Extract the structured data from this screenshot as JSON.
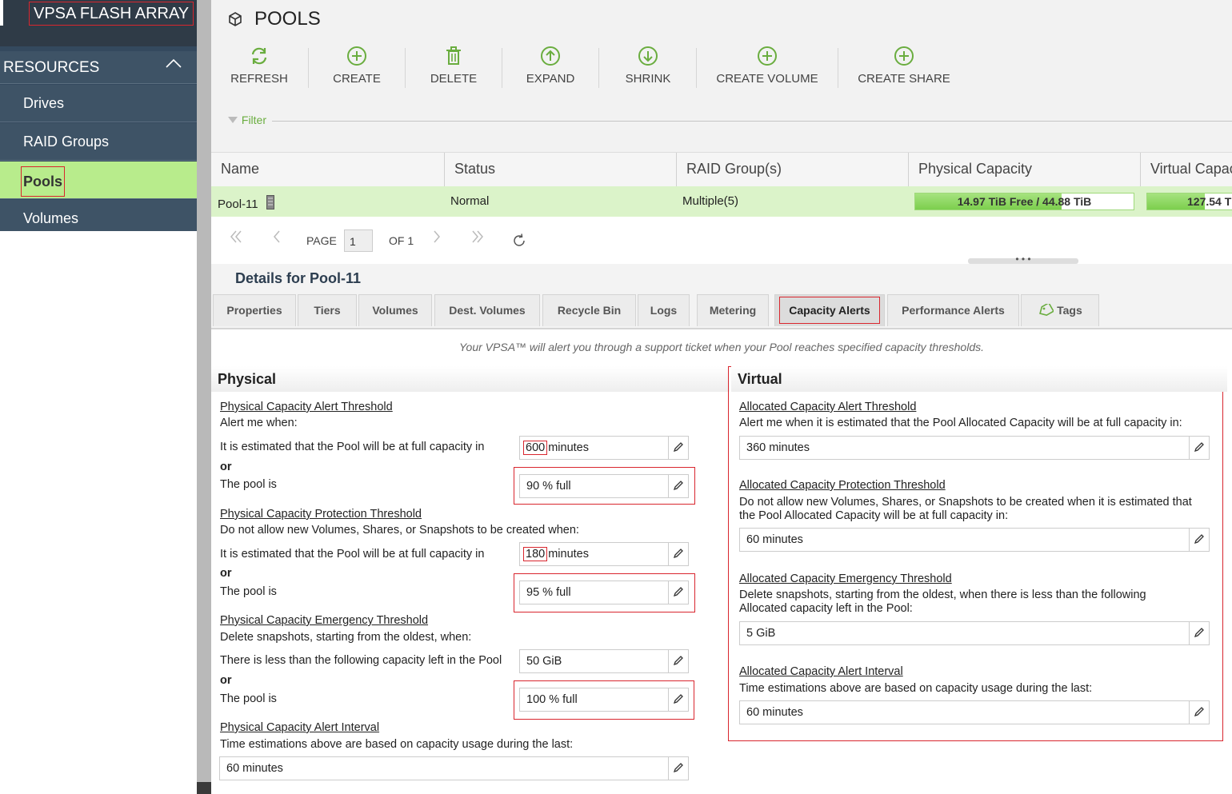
{
  "sidebar": {
    "brand": "VPSA FLASH ARRAY",
    "section": "RESOURCES",
    "items": [
      {
        "label": "Drives"
      },
      {
        "label": "RAID Groups"
      },
      {
        "label": "Pools"
      },
      {
        "label": "Volumes"
      }
    ]
  },
  "page": {
    "title": "POOLS"
  },
  "toolbar": {
    "refresh": "REFRESH",
    "create": "CREATE",
    "delete": "DELETE",
    "expand": "EXPAND",
    "shrink": "SHRINK",
    "create_volume": "CREATE VOLUME",
    "create_share": "CREATE SHARE"
  },
  "filter": {
    "label": "Filter"
  },
  "grid": {
    "columns": [
      "Name",
      "Status",
      "RAID Group(s)",
      "Physical Capacity",
      "Virtual Capac"
    ],
    "row": {
      "name": "Pool-11",
      "status": "Normal",
      "raid_groups": "Multiple(5)",
      "physical_capacity": "14.97 TiB Free / 44.88 TiB",
      "physical_used_fraction": 0.67,
      "virtual_capacity": "127.54 T",
      "virtual_used_fraction": 0.6
    }
  },
  "pager": {
    "page_label": "PAGE",
    "page": "1",
    "of_label": "OF 1"
  },
  "details": {
    "title": "Details for Pool-11",
    "tabs": [
      "Properties",
      "Tiers",
      "Volumes",
      "Dest. Volumes",
      "Recycle Bin",
      "Logs",
      "Metering",
      "Capacity Alerts",
      "Performance Alerts",
      "Tags"
    ],
    "note": "Your VPSA™ will alert you through a support ticket when your Pool reaches specified capacity thresholds."
  },
  "physical": {
    "heading": "Physical",
    "alert_title": "Physical Capacity Alert Threshold",
    "alert_desc": "Alert me when:",
    "estimated_label": "It is estimated that the Pool will be at full capacity in",
    "alert_minutes": "600",
    "minutes_unit": "minutes",
    "or": "or",
    "pool_is_label": "The pool is",
    "alert_full": "90 % full",
    "protection_title": "Physical Capacity Protection Threshold",
    "protection_desc": "Do not allow new Volumes, Shares, or Snapshots to be created when:",
    "protection_minutes": "180",
    "protection_full": "95 % full",
    "emergency_title": "Physical Capacity Emergency Threshold",
    "emergency_desc": "Delete snapshots, starting from the oldest, when:",
    "emergency_less_label": "There is less than the following capacity left in the Pool",
    "emergency_capacity": "50 GiB",
    "emergency_full": "100 % full",
    "interval_title": "Physical Capacity Alert Interval",
    "interval_desc": "Time estimations above are based on capacity usage during the last:",
    "interval_value": "60 minutes"
  },
  "virtual": {
    "heading": "Virtual",
    "alert_title": "Allocated Capacity Alert Threshold",
    "alert_desc": "Alert me when it is estimated that the Pool Allocated Capacity will be at full capacity in:",
    "alert_value": "360 minutes",
    "protection_title": "Allocated Capacity Protection Threshold",
    "protection_desc_1": "Do not allow new Volumes, Shares, or Snapshots to be created when it is estimated that",
    "protection_desc_2": "the Pool Allocated Capacity will be at full capacity in:",
    "protection_value": "60 minutes",
    "emergency_title": "Allocated Capacity Emergency Threshold",
    "emergency_desc_1": "Delete snapshots, starting from the oldest, when there is less than the following",
    "emergency_desc_2": "Allocated capacity left in the Pool:",
    "emergency_value": "5 GiB",
    "interval_title": "Allocated Capacity Alert Interval",
    "interval_desc": "Time estimations above are based on capacity usage during the last:",
    "interval_value": "60 minutes"
  },
  "colors": {
    "sidebar_bg": "#34495e",
    "active_nav": "#b8ec8c",
    "accent_green": "#6aad3f",
    "row_highlight": "#dbf3c9",
    "annotation_red": "#d9262e"
  }
}
